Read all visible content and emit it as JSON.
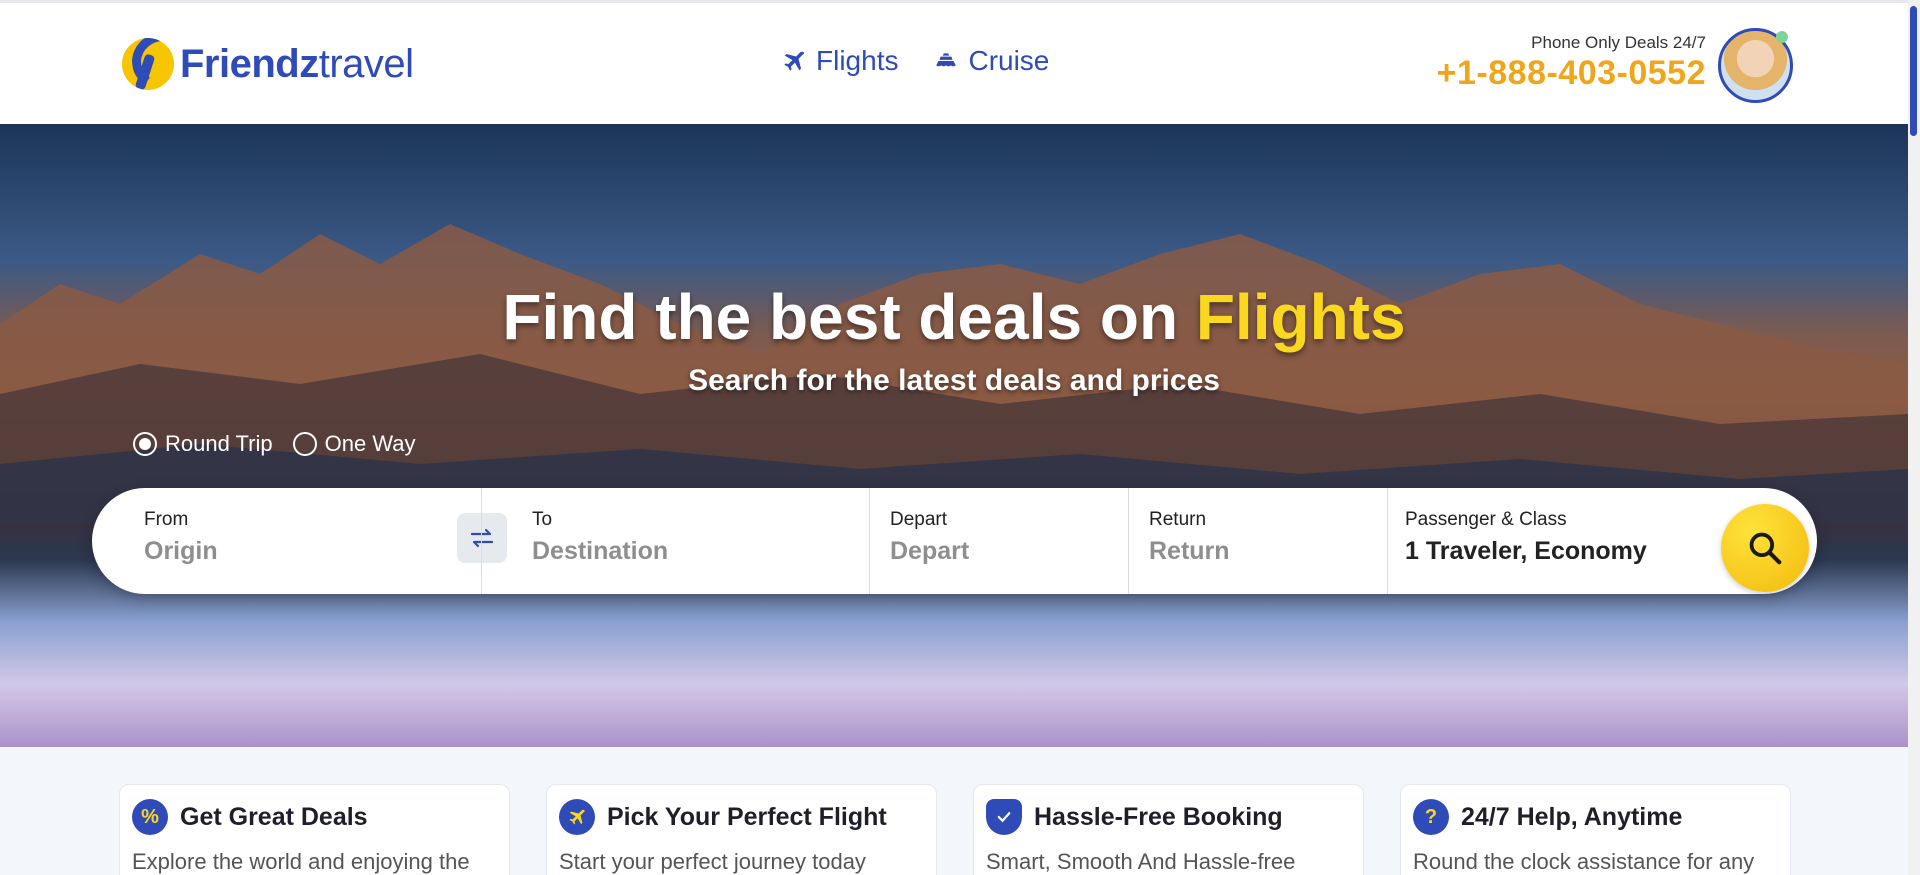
{
  "brand": {
    "name_bold": "Friendz",
    "name_light": "travel",
    "color": "#2f4bb8",
    "accent": "#f0a51a"
  },
  "nav": {
    "items": [
      {
        "label": "Flights",
        "icon": "airplane-icon"
      },
      {
        "label": "Cruise",
        "icon": "ship-icon"
      }
    ]
  },
  "contact": {
    "label": "Phone Only Deals 24/7",
    "phone": "+1-888-403-0552"
  },
  "hero": {
    "title_main": "Find the best deals on ",
    "title_accent": "Flights",
    "subtitle": "Search for the latest deals and prices",
    "trip_types": [
      {
        "label": "Round Trip",
        "selected": true
      },
      {
        "label": "One Way",
        "selected": false
      }
    ]
  },
  "search": {
    "from_label": "From",
    "from_value": "Origin",
    "to_label": "To",
    "to_value": "Destination",
    "depart_label": "Depart",
    "depart_value": "Depart",
    "return_label": "Return",
    "return_value": "Return",
    "passenger_label": "Passenger & Class",
    "passenger_value": "1 Traveler, Economy"
  },
  "features": [
    {
      "title": "Get Great Deals",
      "text": "Explore the world and enjoying the",
      "icon": "percent-badge-icon"
    },
    {
      "title": "Pick Your Perfect Flight",
      "text": "Start your perfect journey today",
      "icon": "airplane-icon"
    },
    {
      "title": "Hassle-Free Booking",
      "text": "Smart, Smooth And Hassle-free",
      "icon": "shield-check-icon"
    },
    {
      "title": "24/7 Help, Anytime",
      "text": "Round the clock assistance for any",
      "icon": "question-icon"
    }
  ]
}
